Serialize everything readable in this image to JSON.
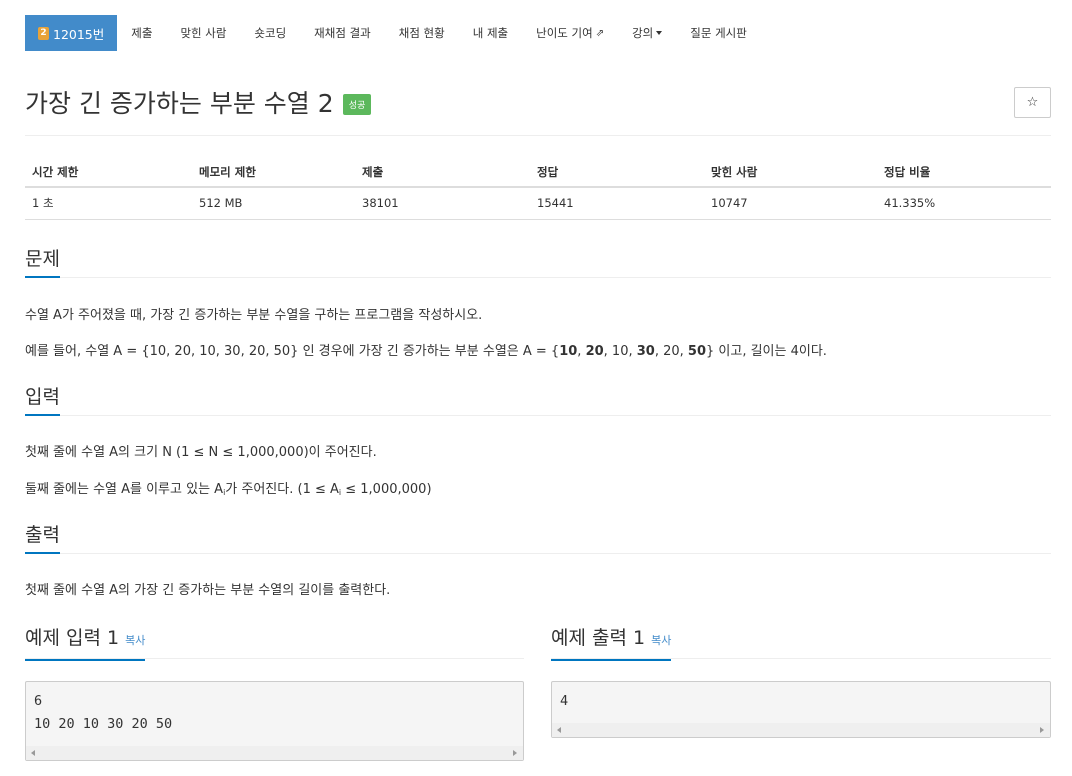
{
  "nav": {
    "problem_tier": "2",
    "problem_label": "12015번",
    "items": [
      "제출",
      "맞힌 사람",
      "숏코딩",
      "재채점 결과",
      "채점 현황",
      "내 제출",
      "난이도 기여",
      "강의",
      "질문 게시판"
    ],
    "external_icon": "external-link-icon",
    "dropdown_icon": "caret-down-icon"
  },
  "title": {
    "text": "가장 긴 증가하는 부분 수열 2",
    "badge": "성공",
    "star": "☆"
  },
  "info": {
    "headers": [
      "시간 제한",
      "메모리 제한",
      "제출",
      "정답",
      "맞힌 사람",
      "정답 비율"
    ],
    "values": [
      "1 초",
      "512 MB",
      "38101",
      "15441",
      "10747",
      "41.335%"
    ]
  },
  "problem": {
    "heading": "문제",
    "line1": "수열 A가 주어졌을 때, 가장 긴 증가하는 부분 수열을 구하는 프로그램을 작성하시오.",
    "line2_a": "예를 들어, 수열 A = {10, 20, 10, 30, 20, 50} 인 경우에 가장 긴 증가하는 부분 수열은 A = {",
    "line2_b1": "10",
    "line2_s1": ", ",
    "line2_b2": "20",
    "line2_s2": ", 10, ",
    "line2_b3": "30",
    "line2_s3": ", 20, ",
    "line2_b4": "50",
    "line2_c": "} 이고, 길이는 4이다."
  },
  "input": {
    "heading": "입력",
    "line1": "첫째 줄에 수열 A의 크기 N (1 ≤ N ≤ 1,000,000)이 주어진다.",
    "line2_a": "둘째 줄에는 수열 A를 이루고 있는 A",
    "line2_sub": "i",
    "line2_b": "가 주어진다. (1 ≤ A",
    "line2_sub2": "i",
    "line2_c": " ≤ 1,000,000)"
  },
  "output": {
    "heading": "출력",
    "line1": "첫째 줄에 수열 A의 가장 긴 증가하는 부분 수열의 길이를 출력한다."
  },
  "samples": {
    "input_heading": "예제 입력 1",
    "output_heading": "예제 출력 1",
    "copy": "복사",
    "input_lines": [
      "6",
      "10 20 10 30 20 50"
    ],
    "output_lines": [
      "4"
    ]
  }
}
